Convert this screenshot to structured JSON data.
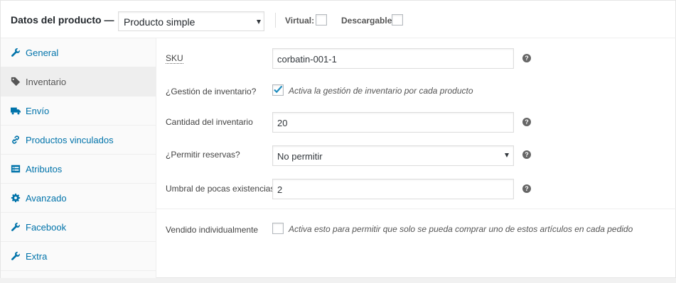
{
  "header": {
    "title": "Datos del producto —",
    "product_type": "Producto simple",
    "virtual_label": "Virtual:",
    "downloadable_label": "Descargable:",
    "virtual_checked": false,
    "downloadable_checked": false
  },
  "tabs": [
    {
      "label": "General",
      "icon": "wrench-icon",
      "active": false
    },
    {
      "label": "Inventario",
      "icon": "tag-icon",
      "active": true
    },
    {
      "label": "Envío",
      "icon": "truck-icon",
      "active": false
    },
    {
      "label": "Productos vinculados",
      "icon": "link-icon",
      "active": false
    },
    {
      "label": "Atributos",
      "icon": "list-icon",
      "active": false
    },
    {
      "label": "Avanzado",
      "icon": "gear-icon",
      "active": false
    },
    {
      "label": "Facebook",
      "icon": "wrench-icon",
      "active": false
    },
    {
      "label": "Extra",
      "icon": "wrench-icon",
      "active": false
    }
  ],
  "inventory": {
    "sku_label": "SKU",
    "sku_value": "corbatin-001-1",
    "manage_stock_label": "¿Gestión de inventario?",
    "manage_stock_desc": "Activa la gestión de inventario por cada producto",
    "manage_stock_checked": true,
    "stock_qty_label": "Cantidad del inventario",
    "stock_qty_value": "20",
    "backorders_label": "¿Permitir reservas?",
    "backorders_value": "No permitir",
    "low_stock_label": "Umbral de pocas existencias",
    "low_stock_value": "2",
    "sold_individually_label": "Vendido individualmente",
    "sold_individually_desc": "Activa esto para permitir que solo se pueda comprar uno de estos artículos en cada pedido",
    "sold_individually_checked": false,
    "help_glyph": "?"
  },
  "colors": {
    "link": "#0073aa",
    "active_tab_bg": "#eeeeee",
    "checkmark": "#1e8cbe"
  }
}
